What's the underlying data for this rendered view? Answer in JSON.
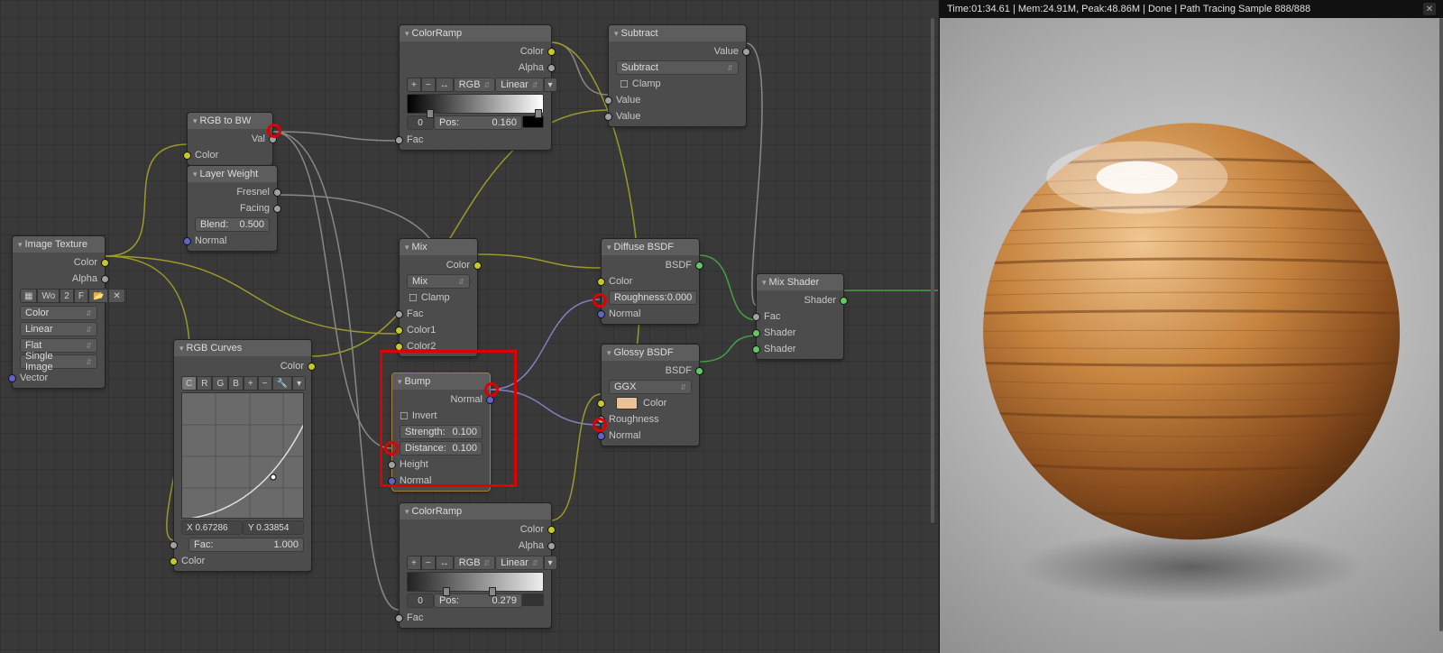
{
  "status_bar": "Time:01:34.61 | Mem:24.91M, Peak:48.86M | Done | Path Tracing Sample 888/888",
  "nodes": {
    "image_texture": {
      "title": "Image Texture",
      "o_color": "Color",
      "o_alpha": "Alpha",
      "tex_name": "Wo",
      "ds": "2",
      "f_btn": "F",
      "color_mode": "Color",
      "interp": "Linear",
      "proj": "Flat",
      "frame": "Single Image",
      "vector": "Vector"
    },
    "rgb_to_bw": {
      "title": "RGB to BW",
      "o_val": "Val",
      "i_color": "Color"
    },
    "layer_weight": {
      "title": "Layer Weight",
      "o_fresnel": "Fresnel",
      "o_facing": "Facing",
      "blend_label": "Blend:",
      "blend_val": "0.500",
      "i_normal": "Normal"
    },
    "rgb_curves": {
      "title": "RGB Curves",
      "o_color": "Color",
      "tabs_c": "C",
      "tabs_r": "R",
      "tabs_g": "G",
      "tabs_b": "B",
      "x_label": "X 0.67286",
      "y_label": "Y 0.33854",
      "fac_label": "Fac:",
      "fac_val": "1.000",
      "i_color": "Color"
    },
    "colorramp1": {
      "title": "ColorRamp",
      "o_color": "Color",
      "o_alpha": "Alpha",
      "mode": "RGB",
      "interp": "Linear",
      "idx": "0",
      "pos_label": "Pos:",
      "pos_val": "0.160",
      "i_fac": "Fac"
    },
    "colorramp2": {
      "title": "ColorRamp",
      "o_color": "Color",
      "o_alpha": "Alpha",
      "mode": "RGB",
      "interp": "Linear",
      "idx": "0",
      "pos_label": "Pos:",
      "pos_val": "0.279",
      "i_fac": "Fac"
    },
    "subtract": {
      "title": "Subtract",
      "o_value": "Value",
      "op": "Subtract",
      "clamp": "Clamp",
      "i_val1": "Value",
      "i_val2": "Value"
    },
    "mix": {
      "title": "Mix",
      "o_color": "Color",
      "mode": "Mix",
      "clamp": "Clamp",
      "i_fac": "Fac",
      "i_col1": "Color1",
      "i_col2": "Color2"
    },
    "bump": {
      "title": "Bump",
      "o_normal": "Normal",
      "invert": "Invert",
      "str_label": "Strength:",
      "str_val": "0.100",
      "dist_label": "Distance:",
      "dist_val": "0.100",
      "i_height": "Height",
      "i_normal": "Normal"
    },
    "diffuse": {
      "title": "Diffuse BSDF",
      "o_bsdf": "BSDF",
      "i_color": "Color",
      "rough_label": "Roughness:",
      "rough_val": "0.000",
      "i_normal": "Normal"
    },
    "glossy": {
      "title": "Glossy BSDF",
      "o_bsdf": "BSDF",
      "dist": "GGX",
      "i_color": "Color",
      "i_rough": "Roughness",
      "i_normal": "Normal"
    },
    "mixshader": {
      "title": "Mix Shader",
      "o_shader": "Shader",
      "i_fac": "Fac",
      "i_shader1": "Shader",
      "i_shader2": "Shader"
    }
  }
}
